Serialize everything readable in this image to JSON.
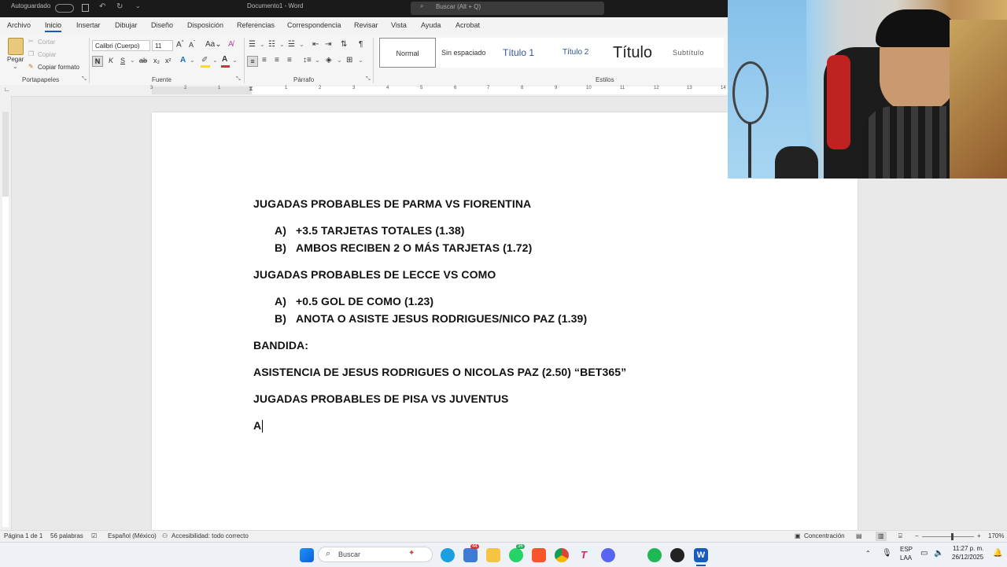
{
  "titlebar": {
    "autosave": "Autoguardado",
    "doc_title": "Documento1 - Word",
    "search_placeholder": "Buscar (Alt + Q)"
  },
  "menu": {
    "tabs": [
      "Archivo",
      "Inicio",
      "Insertar",
      "Dibujar",
      "Diseño",
      "Disposición",
      "Referencias",
      "Correspondencia",
      "Revisar",
      "Vista",
      "Ayuda",
      "Acrobat"
    ],
    "active": "Inicio"
  },
  "ribbon": {
    "clipboard": {
      "paste": "Pegar",
      "cut": "Cortar",
      "copy": "Copiar",
      "format_painter": "Copiar formato",
      "label": "Portapapeles"
    },
    "font": {
      "name": "Calibri (Cuerpo)",
      "size": "11",
      "label": "Fuente"
    },
    "paragraph": {
      "label": "Párrafo"
    },
    "styles": {
      "items": [
        "Normal",
        "Sin espaciado",
        "Título 1",
        "Título 2",
        "Título",
        "Subtítulo"
      ],
      "label": "Estilos"
    }
  },
  "ruler": {
    "numbers": [
      "3",
      "2",
      "1",
      "1",
      "2",
      "3",
      "4",
      "5",
      "6",
      "7",
      "8",
      "9",
      "10",
      "11",
      "12",
      "13",
      "14"
    ]
  },
  "document": {
    "lines": [
      "JUGADAS PROBABLES DE PARMA VS FIORENTINA",
      "A)",
      "+3.5 TARJETAS TOTALES (1.38)",
      "B)",
      "AMBOS RECIBEN 2 O MÁS TARJETAS (1.72)",
      "JUGADAS PROBABLES DE LECCE VS COMO",
      "A)",
      "+0.5 GOL DE COMO (1.23)",
      "B)",
      "ANOTA O ASISTE JESUS RODRIGUES/NICO PAZ (1.39)",
      "BANDIDA:",
      "ASISTENCIA DE JESUS RODRIGUES O NICOLAS PAZ (2.50) “BET365”",
      "JUGADAS PROBABLES DE PISA VS JUVENTUS",
      "A"
    ]
  },
  "statusbar": {
    "page": "Página 1 de 1",
    "words": "56 palabras",
    "language": "Español (México)",
    "accessibility": "Accesibilidad: todo correcto",
    "focus": "Concentración",
    "zoom": "170%"
  },
  "taskbar": {
    "search": "Buscar",
    "lang_top": "ESP",
    "lang_bottom": "LAA",
    "time": "11:27 p. m.",
    "date": "26/12/2025",
    "badge_a": "44",
    "badge_b": "36"
  },
  "colors": {
    "word_blue": "#185abd",
    "accent_highlight": "#f7e000",
    "font_red": "#d13438"
  }
}
